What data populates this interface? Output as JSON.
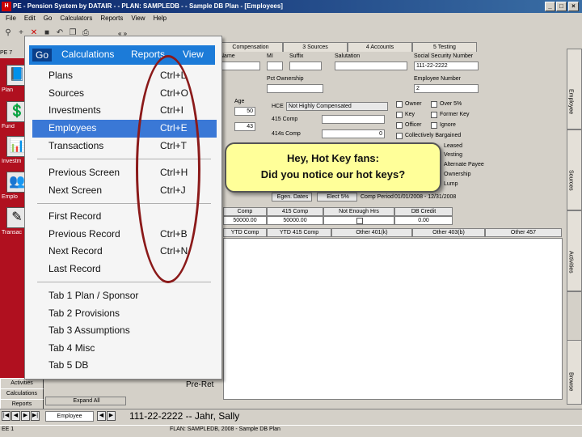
{
  "window": {
    "title": "PE - Pension System by DATAIR - - PLAN: SAMPLEDB - - Sample DB Plan - [Employees]",
    "icon_glyph": "H",
    "minimize": "_",
    "maximize": "□",
    "close": "×"
  },
  "menubar": [
    "File",
    "Edit",
    "Go",
    "Calculators",
    "Reports",
    "View",
    "Help"
  ],
  "toolbar": {
    "arrows": "« »"
  },
  "leftnav": {
    "tab_label": "PE 7",
    "items": [
      {
        "label": "Plan"
      },
      {
        "label": "Fund"
      },
      {
        "label": "Investm"
      },
      {
        "label": "Emplo"
      },
      {
        "label": "Transac"
      }
    ]
  },
  "bottom_left": [
    "Activities",
    "Calculations",
    "Reports"
  ],
  "menu": {
    "headers": [
      "Go",
      "Calculations",
      "Reports",
      "View"
    ],
    "groups": [
      [
        {
          "label": "Plans",
          "shortcut": "Ctrl+L"
        },
        {
          "label": "Sources",
          "shortcut": "Ctrl+O"
        },
        {
          "label": "Investments",
          "shortcut": "Ctrl+I"
        },
        {
          "label": "Employees",
          "shortcut": "Ctrl+E",
          "selected": true
        },
        {
          "label": "Transactions",
          "shortcut": "Ctrl+T"
        }
      ],
      [
        {
          "label": "Previous Screen",
          "shortcut": "Ctrl+H"
        },
        {
          "label": "Next Screen",
          "shortcut": "Ctrl+J"
        }
      ],
      [
        {
          "label": "First Record",
          "shortcut": ""
        },
        {
          "label": "Previous Record",
          "shortcut": "Ctrl+B"
        },
        {
          "label": "Next Record",
          "shortcut": "Ctrl+N"
        },
        {
          "label": "Last Record",
          "shortcut": ""
        }
      ],
      [
        {
          "label": "Tab 1 Plan / Sponsor",
          "shortcut": ""
        },
        {
          "label": "Tab 2 Provisions",
          "shortcut": ""
        },
        {
          "label": "Tab 3 Assumptions",
          "shortcut": ""
        },
        {
          "label": "Tab 4 Misc",
          "shortcut": ""
        },
        {
          "label": "Tab 5 DB",
          "shortcut": ""
        }
      ]
    ]
  },
  "callout": {
    "line1": "Hey, Hot Key fans:",
    "line2": "Did you notice our hot keys?"
  },
  "content": {
    "tabs": [
      "Compensation",
      "3 Sources",
      "4 Accounts",
      "5 Testing"
    ],
    "labels": {
      "name": "Name",
      "mi": "MI",
      "suffix": "Suffix",
      "salutation": "Salutation",
      "ssn": "Social Security Number",
      "ssn_value": "111-22-2222",
      "pct_ownership": "Pct Ownership",
      "employee_number": "Employee Number",
      "employee_number_value": "2",
      "age": "Age",
      "age_value1": "50",
      "age_value2": "43",
      "hce": "HCE",
      "hce_value": "Not Highly Compensated",
      "c415": "415 Comp",
      "c414": "414s Comp",
      "c414_value": "0",
      "egen": "Egen. Dates",
      "elect": "Elect 5%",
      "comp_period": "Comp Period",
      "comp_period_value": "01/01/2008 - 12/31/2008",
      "expand": "Expand All",
      "preret": "Pre-Ret"
    },
    "checkboxes": [
      "Owner",
      "Key",
      "Officer",
      "Collectively Bargained",
      "Leased",
      "Over 5%",
      "Former Key",
      "Ignore"
    ],
    "right_texts": [
      "Employee",
      "Sources",
      "Activities",
      "Browse"
    ],
    "overflow_texts": [
      "Vesting",
      "Lump",
      "Alternate Payee",
      "Ownership"
    ],
    "grid1": {
      "headers": [
        "Comp",
        "415 Comp",
        "Not Enough Hrs",
        "DB Credit"
      ],
      "row": [
        "50000.00",
        "50000.00",
        "",
        "0.00"
      ]
    },
    "grid2": {
      "headers": [
        "YTD Comp",
        "YTD 415 Comp",
        "Other 401(k)",
        "Other 403(b)",
        "Other 457"
      ]
    }
  },
  "status": {
    "record": "111-22-2222 -- Jahr, Sally",
    "tab": "Employee",
    "bar": "FLAN: SAMPLEDB, 2008 - Sample DB Plan",
    "left": "EE 1"
  },
  "colors": {
    "nav_red": "#b0101f",
    "menu_blue": "#1c7bd8",
    "highlight": "#3a78d6",
    "callout": "#ffff99",
    "ellipse": "#8b1a1a"
  }
}
